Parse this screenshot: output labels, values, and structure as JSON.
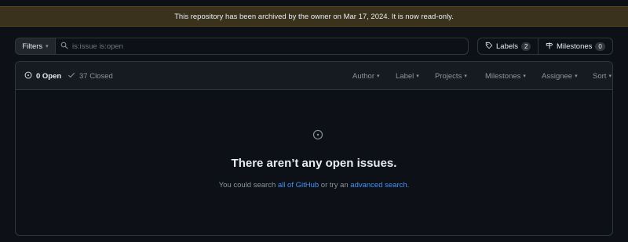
{
  "banner": {
    "text": "This repository has been archived by the owner on Mar 17, 2024. It is now read-only."
  },
  "toolbar": {
    "filters_label": "Filters",
    "search_placeholder": "is:issue is:open",
    "labels_label": "Labels",
    "labels_count": "2",
    "milestones_label": "Milestones",
    "milestones_count": "0"
  },
  "issues_header": {
    "open_label": "0 Open",
    "closed_label": "37 Closed",
    "filters": [
      "Author",
      "Label",
      "Projects",
      "Milestones",
      "Assignee",
      "Sort"
    ]
  },
  "empty_state": {
    "title": "There aren’t any open issues.",
    "sub_prefix": "You could search ",
    "link_all": "all of GitHub",
    "sub_middle": " or try an ",
    "link_advanced": "advanced search",
    "sub_suffix": "."
  },
  "colors": {
    "banner_bg": "#3a321c",
    "link": "#4493f8",
    "background": "#0d1117"
  },
  "icons": [
    "search-icon",
    "tag-icon",
    "milestone-icon",
    "issue-open-icon",
    "check-icon",
    "chevron-down-icon"
  ]
}
